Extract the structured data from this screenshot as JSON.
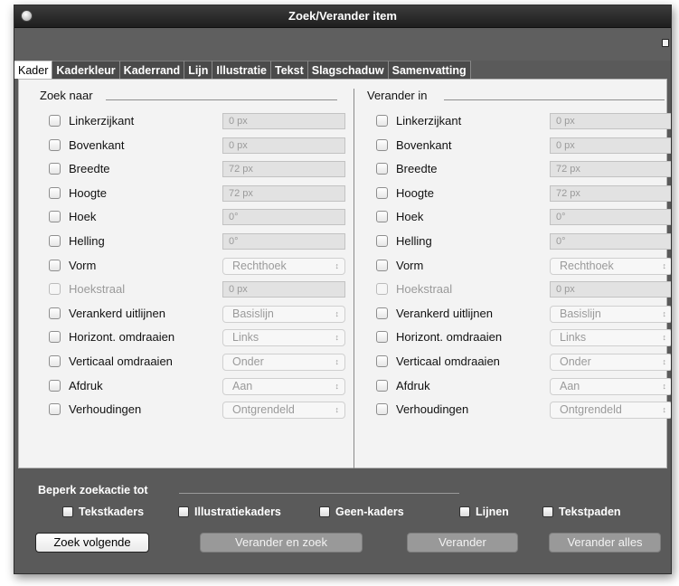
{
  "window": {
    "title": "Zoek/Verander item"
  },
  "tabs": [
    {
      "label": "Kader",
      "active": true
    },
    {
      "label": "Kaderkleur"
    },
    {
      "label": "Kaderrand"
    },
    {
      "label": "Lijn"
    },
    {
      "label": "Illustratie"
    },
    {
      "label": "Tekst"
    },
    {
      "label": "Slagschaduw"
    },
    {
      "label": "Samenvatting"
    }
  ],
  "find": {
    "title": "Zoek naar",
    "rows": [
      {
        "label": "Linkerzijkant",
        "type": "field",
        "value": "0 px"
      },
      {
        "label": "Bovenkant",
        "type": "field",
        "value": "0 px"
      },
      {
        "label": "Breedte",
        "type": "field",
        "value": "72 px"
      },
      {
        "label": "Hoogte",
        "type": "field",
        "value": "72 px"
      },
      {
        "label": "Hoek",
        "type": "field",
        "value": "0°"
      },
      {
        "label": "Helling",
        "type": "field",
        "value": "0°"
      },
      {
        "label": "Vorm",
        "type": "select",
        "value": "Rechthoek"
      },
      {
        "label": "Hoekstraal",
        "type": "field",
        "value": "0 px",
        "disabled": true
      },
      {
        "label": "Verankerd uitlijnen",
        "type": "select",
        "value": "Basislijn"
      },
      {
        "label": "Horizont. omdraaien",
        "type": "select",
        "value": "Links"
      },
      {
        "label": "Verticaal omdraaien",
        "type": "select",
        "value": "Onder"
      },
      {
        "label": "Afdruk",
        "type": "select",
        "value": "Aan"
      },
      {
        "label": "Verhoudingen",
        "type": "select",
        "value": "Ontgrendeld"
      }
    ]
  },
  "change": {
    "title": "Verander in",
    "rows": [
      {
        "label": "Linkerzijkant",
        "type": "field",
        "value": "0 px"
      },
      {
        "label": "Bovenkant",
        "type": "field",
        "value": "0 px"
      },
      {
        "label": "Breedte",
        "type": "field",
        "value": "72 px"
      },
      {
        "label": "Hoogte",
        "type": "field",
        "value": "72 px"
      },
      {
        "label": "Hoek",
        "type": "field",
        "value": "0°"
      },
      {
        "label": "Helling",
        "type": "field",
        "value": "0°"
      },
      {
        "label": "Vorm",
        "type": "select",
        "value": "Rechthoek"
      },
      {
        "label": "Hoekstraal",
        "type": "field",
        "value": "0 px",
        "disabled": true
      },
      {
        "label": "Verankerd uitlijnen",
        "type": "select",
        "value": "Basislijn"
      },
      {
        "label": "Horizont. omdraaien",
        "type": "select",
        "value": "Links"
      },
      {
        "label": "Verticaal omdraaien",
        "type": "select",
        "value": "Onder"
      },
      {
        "label": "Afdruk",
        "type": "select",
        "value": "Aan"
      },
      {
        "label": "Verhoudingen",
        "type": "select",
        "value": "Ontgrendeld"
      }
    ]
  },
  "restrict": {
    "title": "Beperk zoekactie tot",
    "options": [
      {
        "label": "Tekstkaders"
      },
      {
        "label": "Illustratiekaders"
      },
      {
        "label": "Geen-kaders"
      },
      {
        "label": "Lijnen"
      },
      {
        "label": "Tekstpaden"
      }
    ]
  },
  "buttons": {
    "find_next": "Zoek volgende",
    "change_find": "Verander en zoek",
    "change": "Verander",
    "change_all": "Verander alles"
  },
  "icons": {
    "close": "close-dot-icon",
    "panel": "window-toggle-icon",
    "select_arrows": "up-down-arrows-icon"
  }
}
